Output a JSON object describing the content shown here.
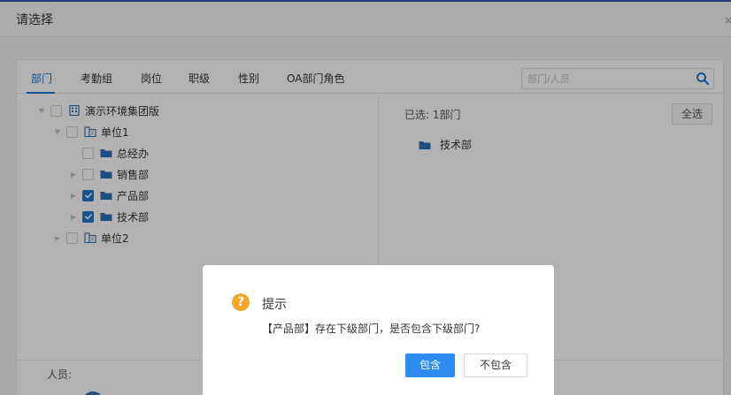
{
  "dialog": {
    "title": "请选择",
    "close": "×"
  },
  "tabs": [
    {
      "label": "部门",
      "active": true
    },
    {
      "label": "考勤组",
      "active": false
    },
    {
      "label": "岗位",
      "active": false
    },
    {
      "label": "职级",
      "active": false
    },
    {
      "label": "性别",
      "active": false
    },
    {
      "label": "OA部门角色",
      "active": false
    }
  ],
  "search": {
    "placeholder": "部门/人员",
    "icon": "search-icon"
  },
  "tree": [
    {
      "label": "演示环境集团版",
      "level": 0,
      "expanded": true,
      "checked": false,
      "icon": "company-icon"
    },
    {
      "label": "单位1",
      "level": 1,
      "expanded": true,
      "checked": false,
      "icon": "building-icon"
    },
    {
      "label": "总经办",
      "level": 2,
      "expanded": null,
      "checked": false,
      "icon": "folder-icon"
    },
    {
      "label": "销售部",
      "level": 2,
      "expanded": false,
      "checked": false,
      "icon": "folder-icon"
    },
    {
      "label": "产品部",
      "level": 2,
      "expanded": false,
      "checked": true,
      "icon": "folder-icon"
    },
    {
      "label": "技术部",
      "level": 2,
      "expanded": false,
      "checked": true,
      "icon": "folder-icon"
    },
    {
      "label": "单位2",
      "level": 1,
      "expanded": false,
      "checked": false,
      "icon": "building-icon"
    }
  ],
  "selected": {
    "count_label": "已选: 1部门",
    "select_all": "全选",
    "items": [
      {
        "label": "技术部",
        "icon": "folder-icon"
      }
    ]
  },
  "people": {
    "label": "人员:"
  },
  "modal": {
    "icon": "?",
    "title": "提示",
    "message": "【产品部】存在下级部门，是否包含下级部门?",
    "confirm": "包含",
    "cancel": "不包含"
  },
  "colors": {
    "accent": "#1f78d1",
    "primary_button": "#2d8cf0",
    "warning": "#f5a623"
  }
}
